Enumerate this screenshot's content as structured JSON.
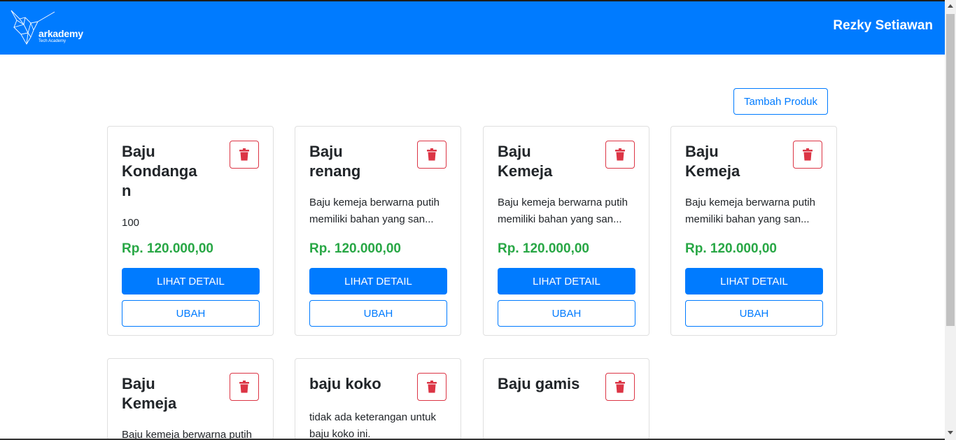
{
  "navbar": {
    "logo_text": "arkademy",
    "logo_sub": "Tech Academy",
    "user_name": "Rezky Setiawan",
    "color": "#007bff"
  },
  "actions": {
    "add_product_label": "Tambah Produk"
  },
  "card_buttons": {
    "detail_label": "LIHAT DETAIL",
    "edit_label": "UBAH"
  },
  "products": [
    {
      "title": "Baju Kondangan",
      "description": "100",
      "price": "Rp. 120.000,00"
    },
    {
      "title": "Baju renang",
      "description": "Baju kemeja berwarna putih memiliki bahan yang san...",
      "price": "Rp. 120.000,00"
    },
    {
      "title": "Baju Kemeja",
      "description": "Baju kemeja berwarna putih memiliki bahan yang san...",
      "price": "Rp. 120.000,00"
    },
    {
      "title": "Baju Kemeja",
      "description": "Baju kemeja berwarna putih memiliki bahan yang san...",
      "price": "Rp. 120.000,00"
    },
    {
      "title": "Baju Kemeja",
      "description": "Baju kemeja berwarna putih",
      "price": ""
    },
    {
      "title": "baju koko",
      "description": "tidak ada keterangan untuk baju koko ini.",
      "price": ""
    },
    {
      "title": "Baju gamis",
      "description": "",
      "price": ""
    }
  ],
  "colors": {
    "primary": "#007bff",
    "danger": "#dc3545",
    "success": "#28a745"
  },
  "icons": {
    "delete": "trash-icon",
    "logo": "hummingbird-logo-icon"
  }
}
